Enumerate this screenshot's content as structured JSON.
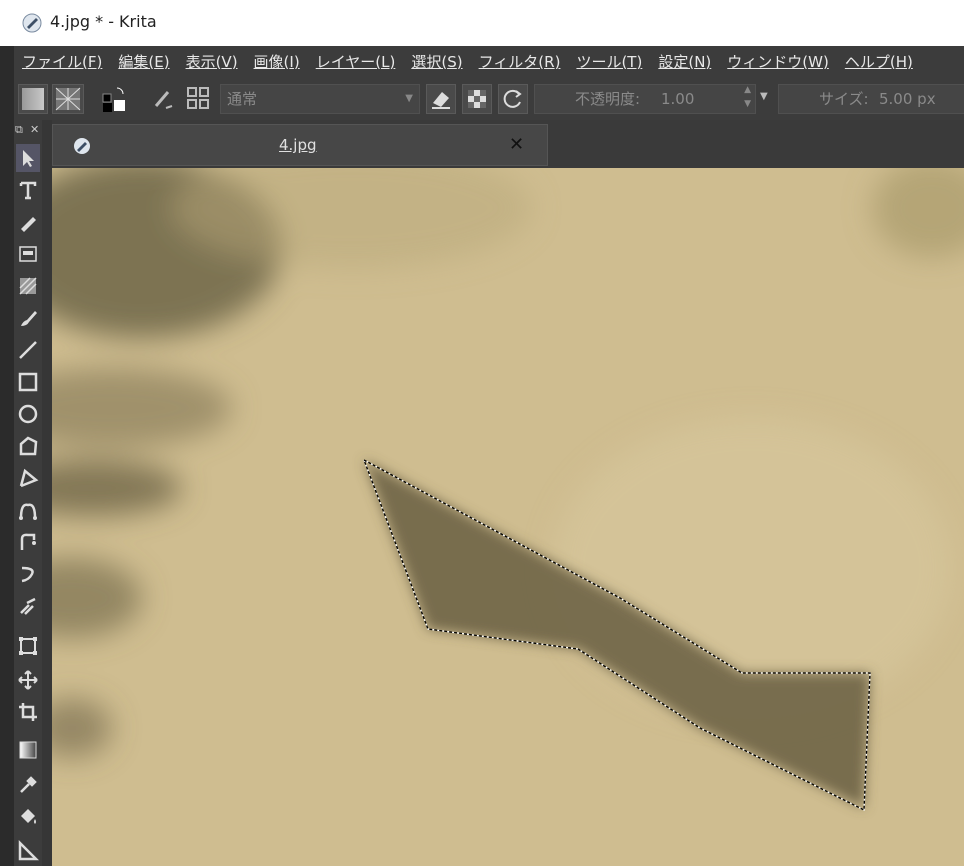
{
  "window": {
    "title": "4.jpg * - Krita"
  },
  "menu": [
    {
      "label": "ファイル(",
      "key": "F",
      "end": ")"
    },
    {
      "label": "編集(",
      "key": "E",
      "end": ")"
    },
    {
      "label": "表示(",
      "key": "V",
      "end": ")"
    },
    {
      "label": "画像(",
      "key": "I",
      "end": ")"
    },
    {
      "label": "レイヤー(",
      "key": "L",
      "end": ")"
    },
    {
      "label": "選択(",
      "key": "S",
      "end": ")"
    },
    {
      "label": "フィルタ(",
      "key": "R",
      "end": ")"
    },
    {
      "label": "ツール(",
      "key": "T",
      "end": ")"
    },
    {
      "label": "設定(",
      "key": "N",
      "end": ")"
    },
    {
      "label": "ウィンドウ(",
      "key": "W",
      "end": ")"
    },
    {
      "label": "ヘルプ(",
      "key": "H",
      "end": ")"
    }
  ],
  "toolbar": {
    "blend_mode": "通常",
    "opacity_label": "不透明度:",
    "opacity_value": "1.00",
    "size_label": "サイズ:",
    "size_value": "5.00 px"
  },
  "tab": {
    "label": "4.jpg",
    "close": "✕"
  },
  "colors": {
    "accent": "#3c3c3c",
    "canvas_tone": "#cdb98a",
    "shadow_tone": "#7d7254"
  },
  "tools": [
    "select-shapes-icon",
    "text-icon",
    "calligraphy-icon",
    "edit-shapes-icon",
    "pattern-icon",
    "brush-icon",
    "line-icon",
    "rectangle-icon",
    "ellipse-icon",
    "polygon-icon",
    "polyline-icon",
    "bezier-icon",
    "freehand-path-icon",
    "dynamic-brush-icon",
    "multibrush-icon",
    "transform-icon",
    "move-icon",
    "crop-icon",
    "gradient-icon",
    "color-picker-icon",
    "fill-icon",
    "measure-icon"
  ]
}
